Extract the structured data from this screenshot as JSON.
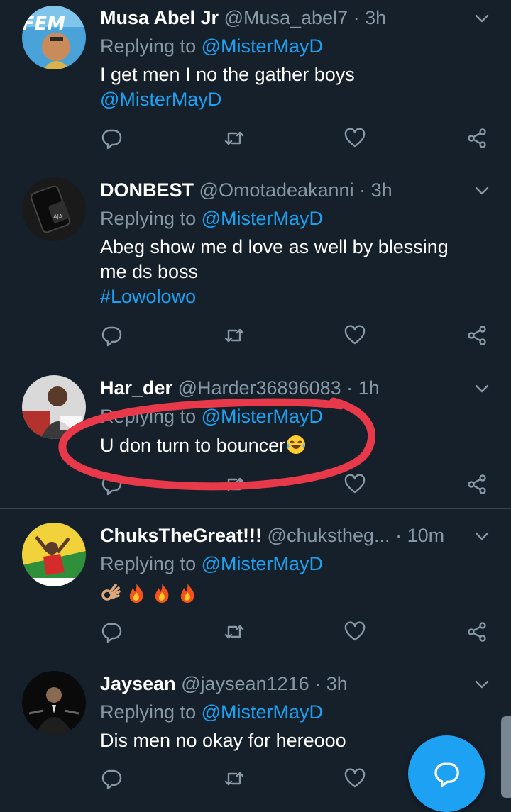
{
  "tweets": [
    {
      "name": "Musa Abel Jr",
      "handle": "@Musa_abel7",
      "time": "3h",
      "replying_label": "Replying to",
      "replying_to": "@MisterMayD",
      "text_line1": "I get men I no the gather boys",
      "text_mention": "@MisterMayD"
    },
    {
      "name": "DONBEST",
      "handle": "@Omotadeakanni",
      "time": "3h",
      "replying_label": "Replying to",
      "replying_to": "@MisterMayD",
      "text_line1": "Abeg show me d love as well by blessing",
      "text_line2": "me ds boss",
      "hashtag": "#Lowolowo"
    },
    {
      "name": "Har_der",
      "handle": "@Harder36896083",
      "time": "1h",
      "replying_label": "Replying to",
      "replying_to": "@MisterMayD",
      "text_line1": "U don turn to bouncer"
    },
    {
      "name": "ChuksTheGreat!!!",
      "handle": "@chukstheg...",
      "time": "10m",
      "replying_label": "Replying to",
      "replying_to": "@MisterMayD",
      "emojis": [
        "ok-hand",
        "fire",
        "fire",
        "fire"
      ]
    },
    {
      "name": "Jaysean",
      "handle": "@jaysean1216",
      "time": "3h",
      "replying_label": "Replying to",
      "replying_to": "@MisterMayD",
      "text_line1": "Dis men no okay for hereooo"
    }
  ],
  "dot": "·",
  "icons": {
    "reply": "reply-icon",
    "retweet": "retweet-icon",
    "like": "heart-icon",
    "share": "share-icon",
    "menu": "chevron-down-icon",
    "compose": "compose-reply-icon"
  },
  "colors": {
    "background": "#15202b",
    "secondary_text": "#8899a6",
    "link": "#1da1f2",
    "divider": "#38444d",
    "annotation": "#e8394a"
  }
}
